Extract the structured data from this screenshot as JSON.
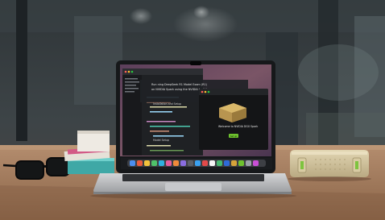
{
  "photo": {
    "subject": "laptop-on-desk-with-compact-desktop-unit",
    "colors": {
      "background": "#3a4245",
      "desk": "#a47c5c",
      "laptop_shell": "#b9bbbe",
      "screen_wallpaper": "#6c4a63",
      "mini_pc": "#cdbf98",
      "accent_green": "#6ec22e"
    },
    "screen": {
      "left_window": {
        "heading_1": "Run ning DeepSeek R1 Model Exam (R1)",
        "heading_2": "on NVIDIA Spark using the NVIDIA toolkit",
        "section_1": "Installation and Setup",
        "section_2": "Model Setup"
      },
      "dialog": {
        "title": "Welcome to NVIDIA DGX Spark",
        "button_label": "Set up"
      }
    }
  }
}
